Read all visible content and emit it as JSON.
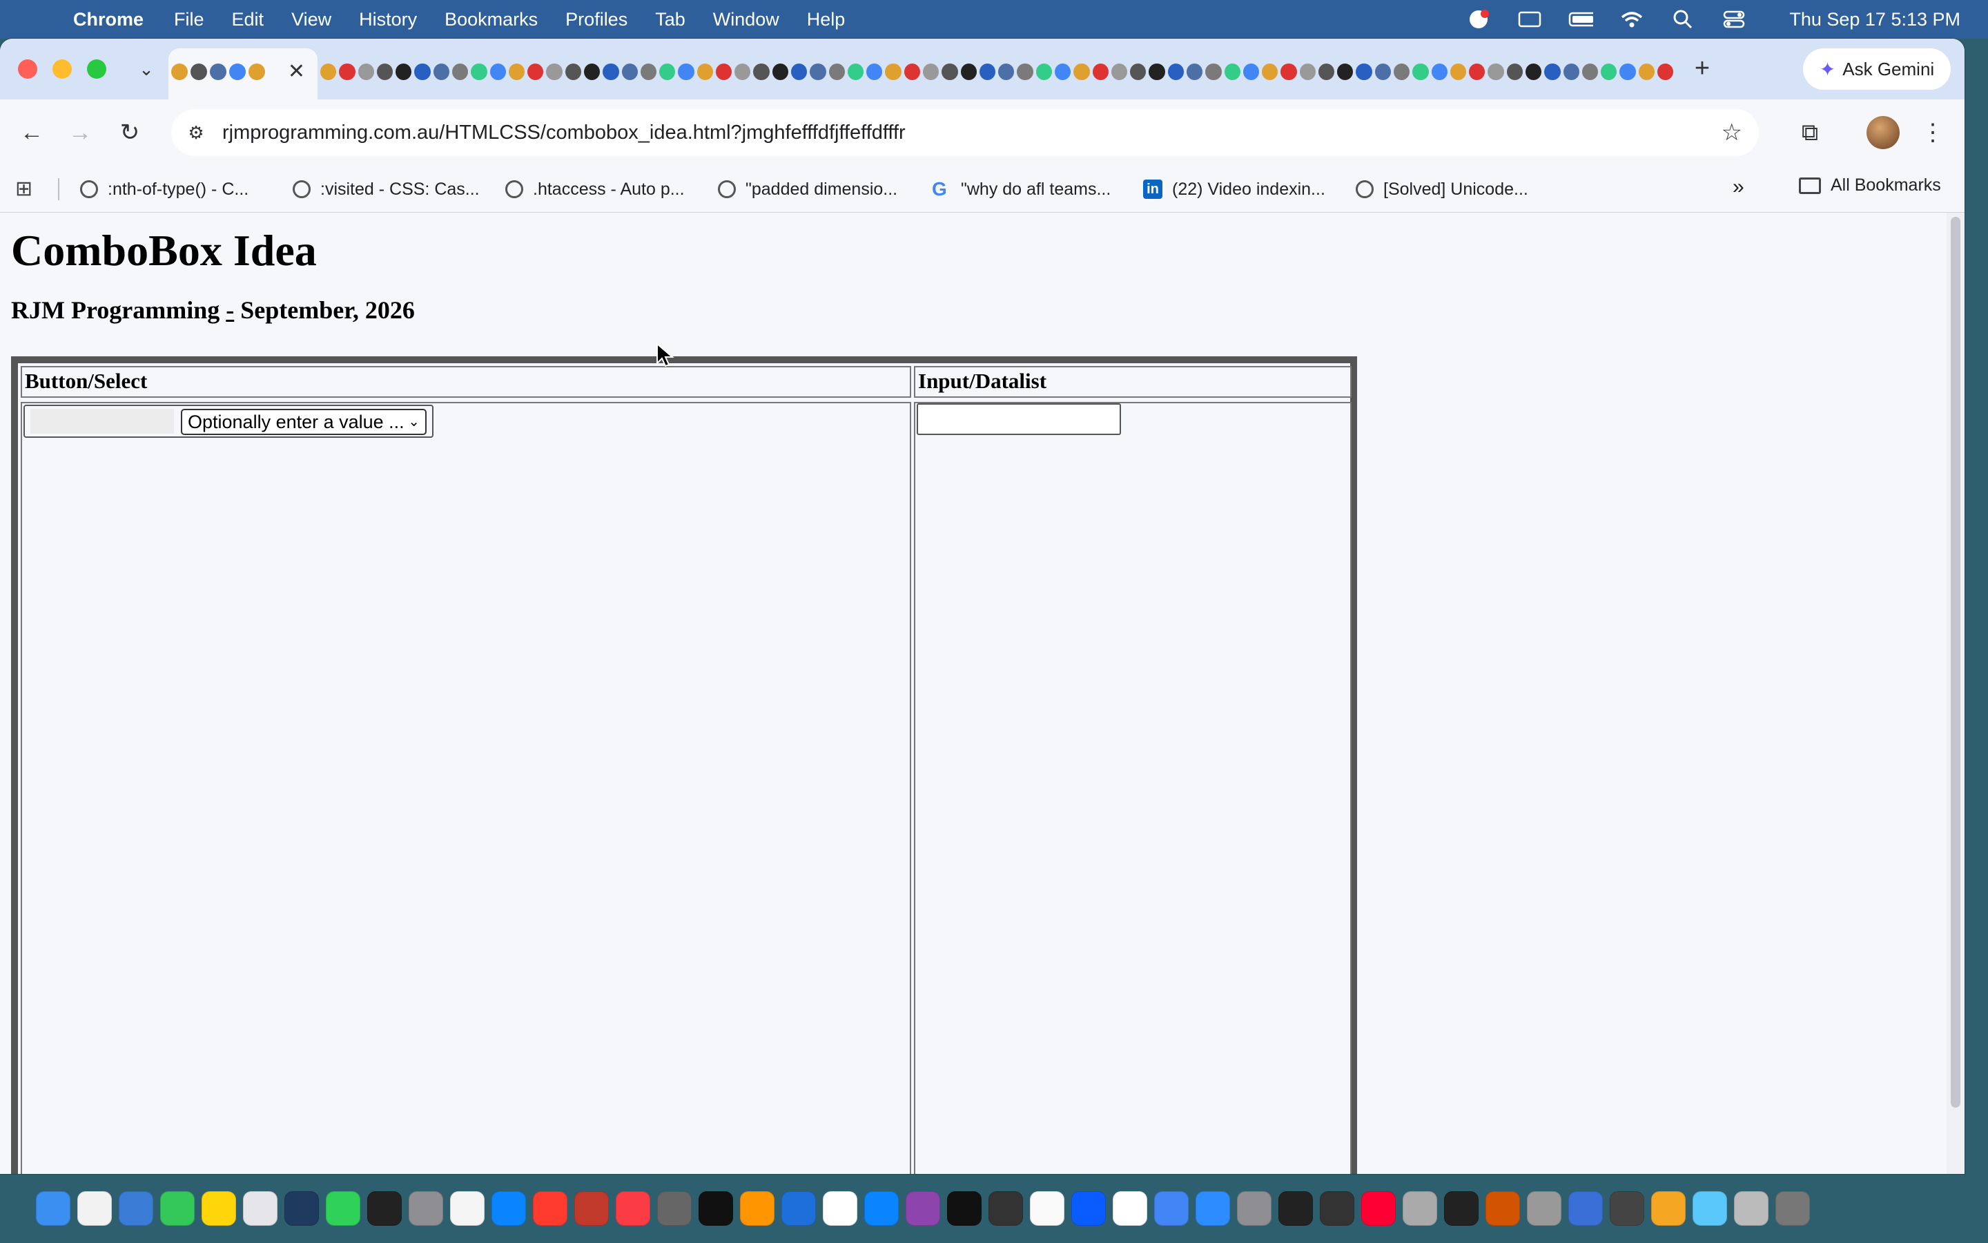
{
  "menubar": {
    "app_name": "Chrome",
    "items": [
      "File",
      "Edit",
      "View",
      "History",
      "Bookmarks",
      "Profiles",
      "Tab",
      "Window",
      "Help"
    ],
    "clock": "Thu Sep 17  5:13 PM"
  },
  "browser": {
    "ask_gemini": "Ask Gemini",
    "url": "rjmprogramming.com.au/HTMLCSS/combobox_idea.html?jmghfefffdfjffeffdfffr",
    "bookmarks": [
      ":nth-of-type() - C...",
      ":visited - CSS: Cas...",
      ".htaccess - Auto p...",
      "\"padded dimensio...",
      "\"why do afl teams...",
      "(22) Video indexin...",
      "[Solved] Unicode..."
    ],
    "all_bookmarks": "All Bookmarks"
  },
  "page": {
    "title": "ComboBox Idea",
    "subtitle_author": "RJM Programming",
    "subtitle_sep": "-",
    "subtitle_date": "September, 2026",
    "table": {
      "col1_header": "Button/Select",
      "col2_header": "Input/Datalist",
      "select_value": "Optionally enter a value ..."
    }
  },
  "colors": {
    "menubar_bg": "#2f5f9a",
    "tabstrip_bg": "#d6e2f5",
    "page_bg": "#f6f7fb"
  },
  "icons": {
    "apple": "apple-icon",
    "back": "back-arrow-icon",
    "forward": "forward-arrow-icon",
    "reload": "reload-icon",
    "star": "bookmark-star-icon",
    "extensions": "puzzle-icon",
    "menu": "kebab-menu-icon"
  }
}
